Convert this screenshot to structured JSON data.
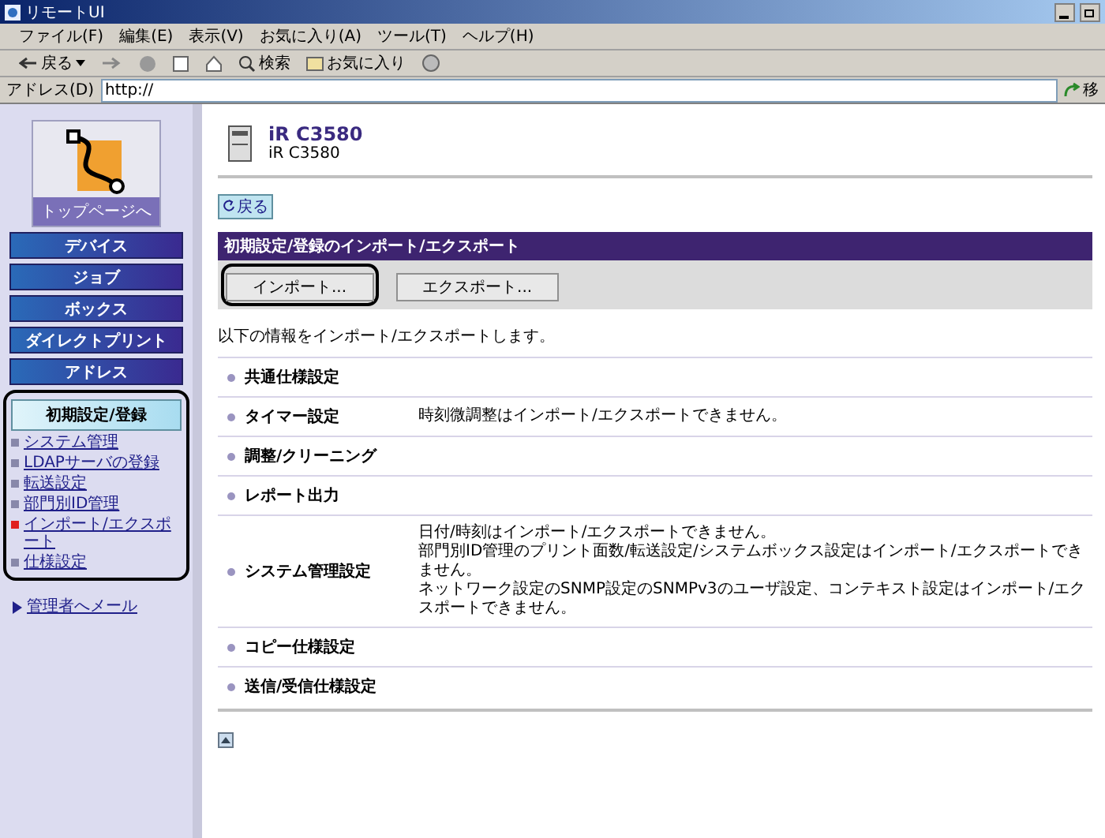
{
  "window": {
    "title": "リモートUI"
  },
  "menu": [
    "ファイル(F)",
    "編集(E)",
    "表示(V)",
    "お気に入り(A)",
    "ツール(T)",
    "ヘルプ(H)"
  ],
  "toolbar": {
    "back": "戻る",
    "search": "検索",
    "favorites": "お気に入り"
  },
  "address": {
    "label": "アドレス(D)",
    "value": "http://",
    "go": "移"
  },
  "sidebar": {
    "top_link": "トップページへ",
    "nav_buttons": [
      "デバイス",
      "ジョブ",
      "ボックス",
      "ダイレクトプリント",
      "アドレス"
    ],
    "section": {
      "title": "初期設定/登録",
      "callout": true,
      "links": [
        {
          "label": "システム管理",
          "selected": false
        },
        {
          "label": "LDAPサーバの登録",
          "selected": false
        },
        {
          "label": "転送設定",
          "selected": false
        },
        {
          "label": "部門別ID管理",
          "selected": false
        },
        {
          "label": "インポート/エクスポート",
          "selected": true
        },
        {
          "label": "仕様設定",
          "selected": false
        }
      ]
    },
    "mail_link": "管理者へメール"
  },
  "main": {
    "device_name": "iR C3580",
    "model": "iR C3580",
    "back_button": "戻る",
    "panel_title": "初期設定/登録のインポート/エクスポート",
    "buttons": [
      {
        "label": "インポート...",
        "callout": true
      },
      {
        "label": "エクスポート...",
        "callout": false
      }
    ],
    "intro": "以下の情報をインポート/エクスポートします。",
    "rows": [
      {
        "label": "共通仕様設定",
        "notes": []
      },
      {
        "label": "タイマー設定",
        "notes": [
          "時刻微調整はインポート/エクスポートできません。"
        ]
      },
      {
        "label": "調整/クリーニング",
        "notes": []
      },
      {
        "label": "レポート出力",
        "notes": []
      },
      {
        "label": "システム管理設定",
        "notes": [
          "日付/時刻はインポート/エクスポートできません。",
          "部門別ID管理のプリント面数/転送設定/システムボックス設定はインポート/エクスポートできません。",
          "ネットワーク設定のSNMP設定のSNMPv3のユーザ設定、コンテキスト設定はインポート/エクスポートできません。"
        ]
      },
      {
        "label": "コピー仕様設定",
        "notes": []
      },
      {
        "label": "送信/受信仕様設定",
        "notes": []
      }
    ]
  }
}
